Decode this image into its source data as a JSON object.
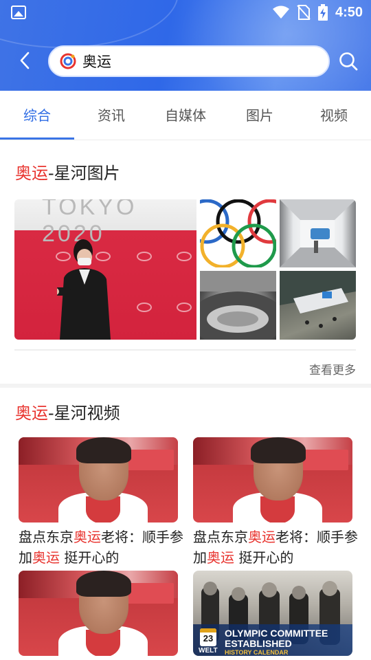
{
  "status_bar": {
    "time": "4:50"
  },
  "search": {
    "query": "奥运"
  },
  "tabs": [
    {
      "label": "综合",
      "active": true
    },
    {
      "label": "资讯",
      "active": false
    },
    {
      "label": "自媒体",
      "active": false
    },
    {
      "label": "图片",
      "active": false
    },
    {
      "label": "视频",
      "active": false
    }
  ],
  "image_section": {
    "title_highlight": "奥运",
    "title_rest": "-星河图片",
    "more_label": "查看更多"
  },
  "video_section": {
    "title_highlight": "奥运",
    "title_rest": "-星河视频",
    "videos": [
      {
        "title_parts": [
          "盘点东京",
          "奥运",
          "老将：顺手参加",
          "奥运",
          " 挺开心的"
        ]
      },
      {
        "title_parts": [
          "盘点东京",
          "奥运",
          "老将：顺手参加",
          "奥运",
          " 挺开心的"
        ]
      },
      {
        "overlay_headline": "OLYMPIC COMMITTEE ESTABLISHED",
        "overlay_brand": "WELT",
        "overlay_sub": "HISTORY CALENDAR",
        "overlay_date": "23"
      }
    ]
  },
  "colors": {
    "accent": "#2d6be4",
    "highlight": "#e8332e"
  },
  "icons": [
    "image-notification-icon",
    "wifi-icon",
    "no-sim-icon",
    "battery-charging-icon",
    "back-arrow-icon",
    "app-logo-icon",
    "search-icon"
  ]
}
